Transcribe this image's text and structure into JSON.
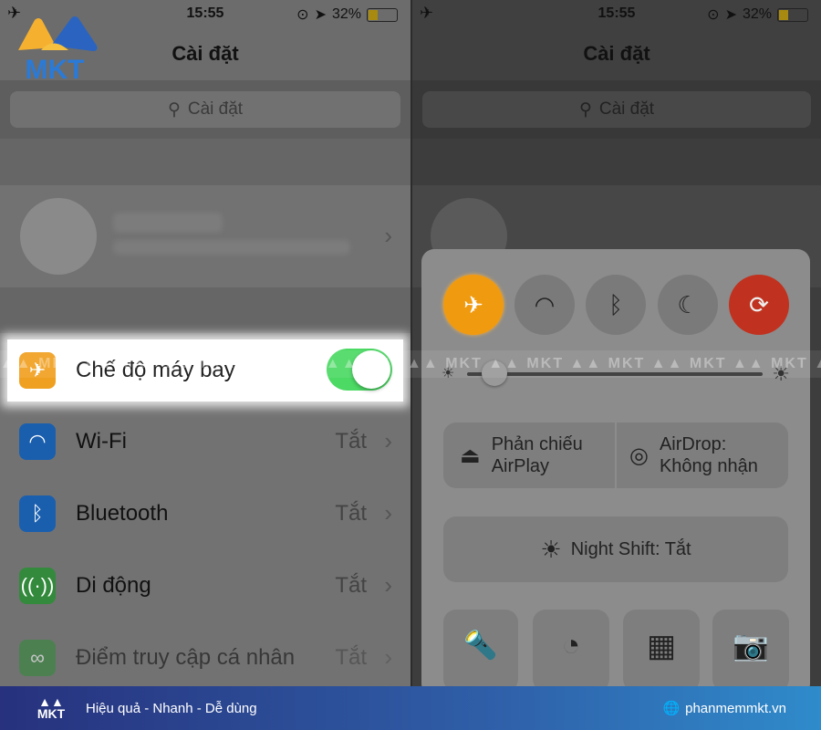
{
  "status": {
    "time": "15:55",
    "battery": "32%",
    "battery_level": 0.32
  },
  "left": {
    "title": "Cài đặt",
    "search_placeholder": "Cài đặt",
    "rows": [
      {
        "label": "Chế độ máy bay",
        "toggle_on": true,
        "icon": "airplane-icon",
        "color": "#ff9500"
      },
      {
        "label": "Wi-Fi",
        "value": "Tắt",
        "icon": "wifi-icon",
        "color": "#1a6fd4"
      },
      {
        "label": "Bluetooth",
        "value": "Tắt",
        "icon": "bluetooth-icon",
        "color": "#1a6fd4"
      },
      {
        "label": "Di động",
        "value": "Tắt",
        "icon": "cellular-icon",
        "color": "#3aa04a"
      },
      {
        "label": "Điểm truy cập cá nhân",
        "value": "Tắt",
        "icon": "hotspot-icon",
        "color": "#3aa04a"
      }
    ]
  },
  "right": {
    "title": "Cài đặt",
    "search_placeholder": "Cài đặt",
    "brightness": 0.05,
    "airplay": "Phản chiếu\nAirPlay",
    "airdrop": "AirDrop:\nKhông nhận",
    "night_shift": "Night Shift: Tắt"
  },
  "watermark": "MKT",
  "logo_text": "MKT",
  "footer": {
    "slogan": "Hiệu quả - Nhanh - Dễ dùng",
    "website": "phanmemmkt.vn"
  }
}
